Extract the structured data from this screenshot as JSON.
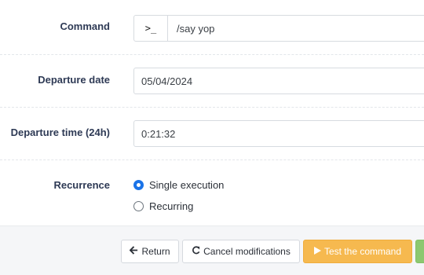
{
  "command": {
    "label": "Command",
    "prompt_symbol": ">_",
    "value": "/say yop"
  },
  "departure_date": {
    "label": "Departure date",
    "value": "05/04/2024"
  },
  "departure_time": {
    "label": "Departure time (24h)",
    "value": "0:21:32"
  },
  "recurrence": {
    "label": "Recurrence",
    "options": [
      {
        "label": "Single execution",
        "checked": true
      },
      {
        "label": "Recurring",
        "checked": false
      }
    ]
  },
  "footer": {
    "return_label": "Return",
    "cancel_label": "Cancel modifications",
    "test_label": "Test the command"
  },
  "colors": {
    "accent": "#1a73e8",
    "test_button": "#f6b94f",
    "green_button": "#8cc870"
  },
  "icons": {
    "return": "arrow-left-icon",
    "cancel": "undo-icon",
    "test": "play-icon"
  }
}
